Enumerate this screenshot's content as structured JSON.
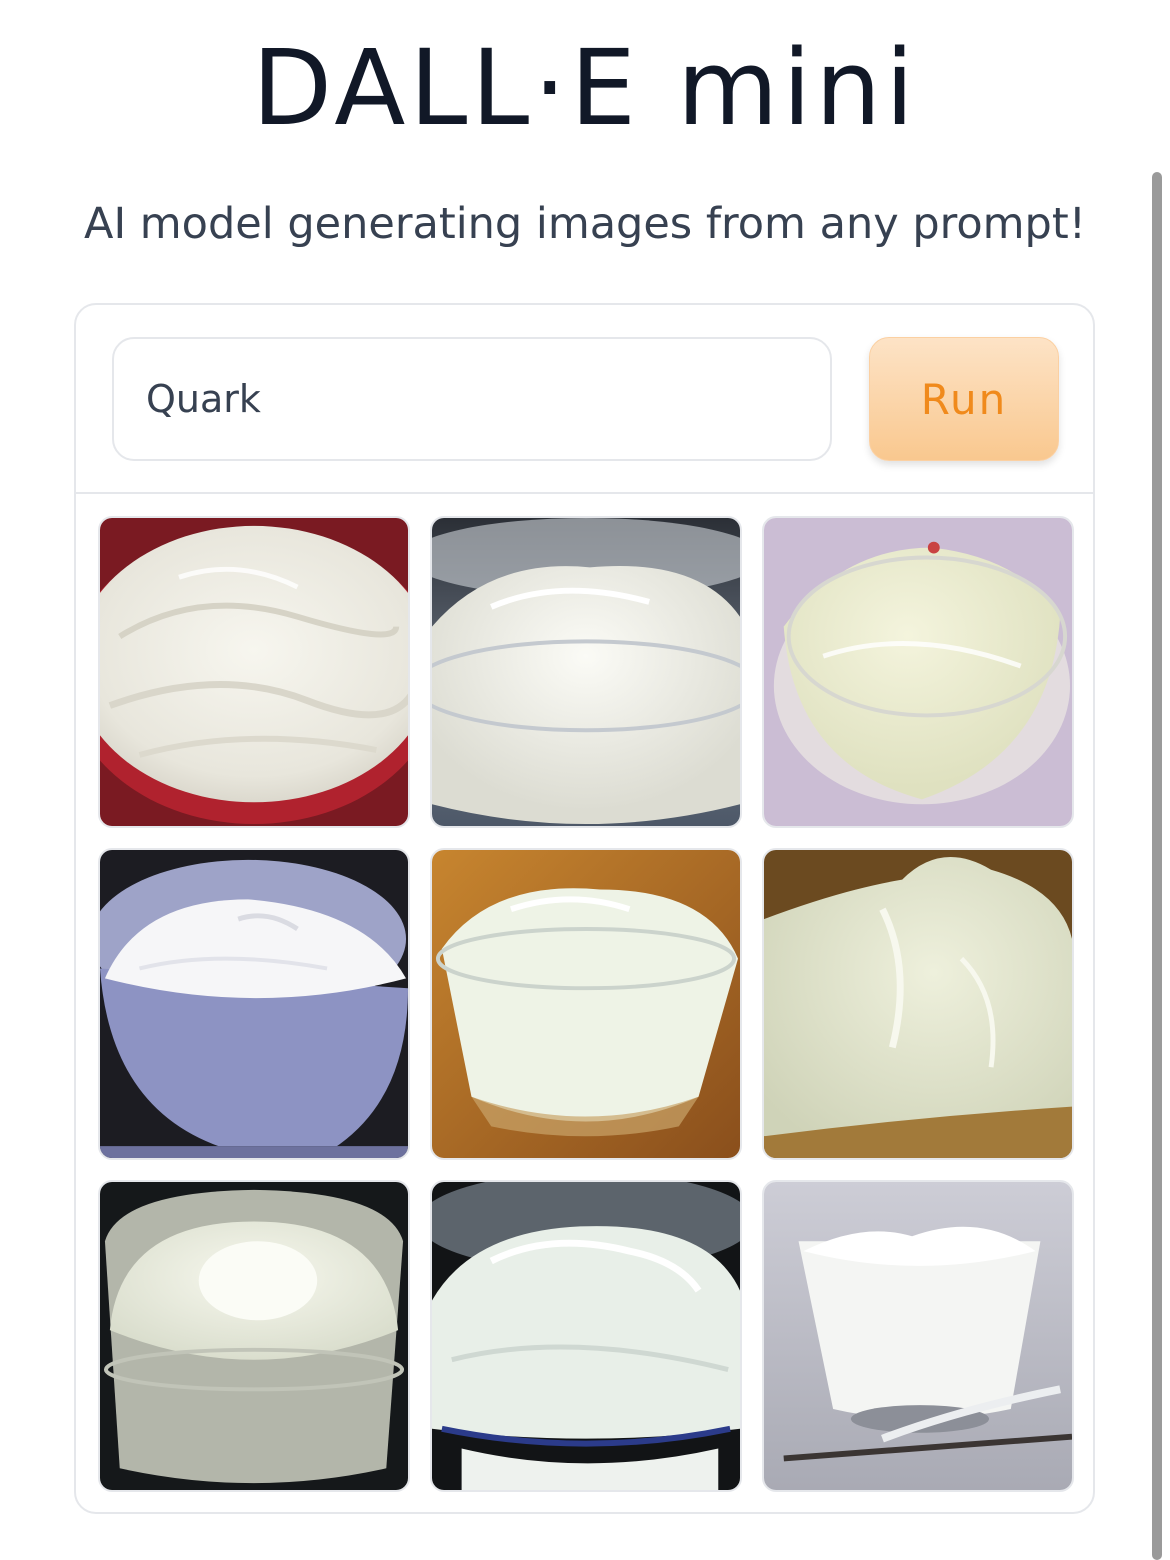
{
  "header": {
    "title": "DALL·E mini",
    "subtitle": "AI model generating images from any prompt!"
  },
  "prompt": {
    "value": "Quark",
    "run_label": "Run"
  },
  "results": {
    "count": 9,
    "images": [
      {
        "subject": "whipped cream in red bowl"
      },
      {
        "subject": "cream in glass bowl"
      },
      {
        "subject": "cream in glass bowl on purple background"
      },
      {
        "subject": "cream in white bowl"
      },
      {
        "subject": "cream in glass bowl on wooden table"
      },
      {
        "subject": "cream close-up"
      },
      {
        "subject": "cream in glass dish"
      },
      {
        "subject": "whipped cream in dark bowl"
      },
      {
        "subject": "cream in glass cup with spoon"
      }
    ]
  },
  "colors": {
    "run_button_text": "#f08a1c",
    "run_button_bg": "#fcd5a8",
    "title_text": "#111827"
  }
}
